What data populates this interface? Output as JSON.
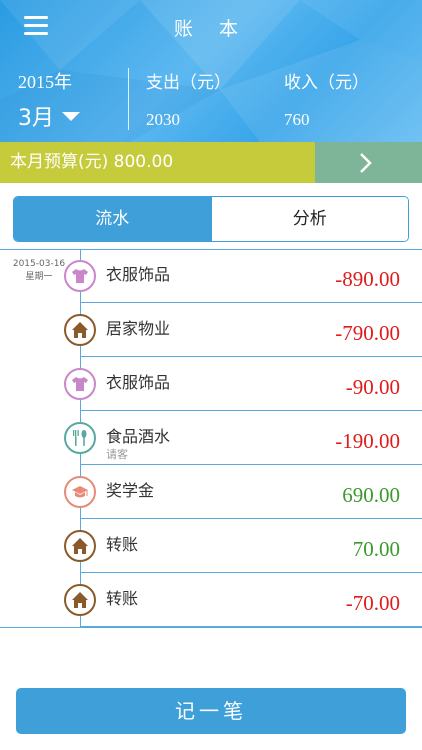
{
  "header": {
    "title": "账 本",
    "year": "2015年",
    "month": "3月",
    "expense_label": "支出（元）",
    "income_label": "收入（元）",
    "expense_value": "2030",
    "income_value": "760"
  },
  "budget": {
    "label": "本月预算(元) 800.00"
  },
  "tabs": [
    {
      "label": "流水",
      "active": true
    },
    {
      "label": "分析",
      "active": false
    }
  ],
  "date_group": {
    "date": "2015-03-16",
    "weekday": "星期一"
  },
  "records": [
    {
      "category": "衣服饰品",
      "note": "",
      "amount": "-890.00",
      "type": "expense",
      "icon": "shirt-icon",
      "color": "#c987c9"
    },
    {
      "category": "居家物业",
      "note": "",
      "amount": "-790.00",
      "type": "expense",
      "icon": "house-icon",
      "color": "#8b5a2b"
    },
    {
      "category": "衣服饰品",
      "note": "",
      "amount": "-90.00",
      "type": "expense",
      "icon": "shirt-icon",
      "color": "#c987c9"
    },
    {
      "category": "食品酒水",
      "note": "请客",
      "amount": "-190.00",
      "type": "expense",
      "icon": "utensils-icon",
      "color": "#5aa8a0"
    },
    {
      "category": "奖学金",
      "note": "",
      "amount": "690.00",
      "type": "income",
      "icon": "graduation-cap-icon",
      "color": "#e78a7a"
    },
    {
      "category": "转账",
      "note": "",
      "amount": "70.00",
      "type": "income",
      "icon": "house-icon",
      "color": "#8b5a2b"
    },
    {
      "category": "转账",
      "note": "",
      "amount": "-70.00",
      "type": "expense",
      "icon": "house-icon",
      "color": "#8b5a2b"
    }
  ],
  "add_button": {
    "label": "记一笔"
  },
  "colors": {
    "primary": "#3e9fd9",
    "budget_bg": "#c6cb3b",
    "budget_go_bg": "#7eb497",
    "expense": "#e01b1b",
    "income": "#3a9a2c"
  }
}
